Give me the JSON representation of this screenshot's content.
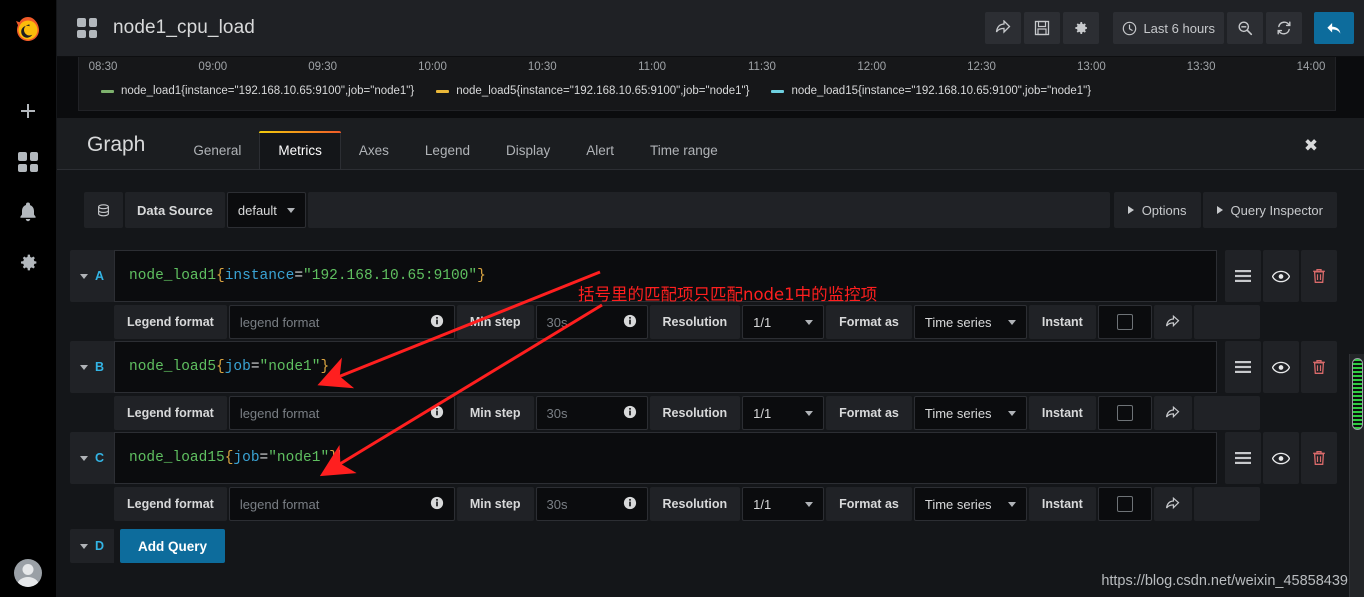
{
  "sidebar": {
    "logo": "grafana-logo",
    "items": [
      {
        "name": "create",
        "icon": "plus-icon"
      },
      {
        "name": "dashboards",
        "icon": "dashboards-icon"
      },
      {
        "name": "alerting",
        "icon": "bell-icon"
      },
      {
        "name": "configuration",
        "icon": "gear-icon"
      }
    ],
    "avatar": "user-avatar"
  },
  "topbar": {
    "dashboard_icon": "dashboards-icon",
    "title": "node1_cpu_load",
    "share_label": "",
    "save_label": "",
    "settings_label": "",
    "time_range": "Last 6 hours",
    "time_icon": "clock-icon",
    "zoom_out_label": "",
    "refresh_label": "",
    "back_label": ""
  },
  "graph": {
    "axis_ticks": [
      "08:30",
      "09:00",
      "09:30",
      "10:00",
      "10:30",
      "11:00",
      "11:30",
      "12:00",
      "12:30",
      "13:00",
      "13:30",
      "14:00"
    ],
    "legend": [
      {
        "label": "node_load1{instance=\"192.168.10.65:9100\",job=\"node1\"}",
        "color": "#7eb26d"
      },
      {
        "label": "node_load5{instance=\"192.168.10.65:9100\",job=\"node1\"}",
        "color": "#eab839"
      },
      {
        "label": "node_load15{instance=\"192.168.10.65:9100\",job=\"node1\"}",
        "color": "#6ed0e0"
      }
    ]
  },
  "chart_data": {
    "type": "line",
    "title": "node1_cpu_load",
    "xlabel": "",
    "ylabel": "",
    "x_ticks": [
      "08:30",
      "09:00",
      "09:30",
      "10:00",
      "10:30",
      "11:00",
      "11:30",
      "12:00",
      "12:30",
      "13:00",
      "13:30",
      "14:00"
    ],
    "series": [
      {
        "name": "node_load1{instance=\"192.168.10.65:9100\",job=\"node1\"}",
        "color": "#7eb26d",
        "values": []
      },
      {
        "name": "node_load5{instance=\"192.168.10.65:9100\",job=\"node1\"}",
        "color": "#eab839",
        "values": []
      },
      {
        "name": "node_load15{instance=\"192.168.10.65:9100\",job=\"node1\"}",
        "color": "#6ed0e0",
        "values": []
      }
    ],
    "legend_position": "bottom",
    "grid": false
  },
  "panel": {
    "title": "Graph",
    "tabs": [
      {
        "label": "General",
        "active": false
      },
      {
        "label": "Metrics",
        "active": true
      },
      {
        "label": "Axes",
        "active": false
      },
      {
        "label": "Legend",
        "active": false
      },
      {
        "label": "Display",
        "active": false
      },
      {
        "label": "Alert",
        "active": false
      },
      {
        "label": "Time range",
        "active": false
      }
    ],
    "close_label": "✖"
  },
  "datasource": {
    "icon": "database-icon",
    "label": "Data Source",
    "value": "default",
    "options_label": "Options",
    "query_inspector_label": "Query Inspector"
  },
  "options_row": {
    "legend_format_label": "Legend format",
    "legend_format_placeholder": "legend format",
    "min_step_label": "Min step",
    "min_step_placeholder": "30s",
    "resolution_label": "Resolution",
    "resolution_value": "1/1",
    "format_as_label": "Format as",
    "format_as_value": "Time series",
    "instant_label": "Instant",
    "instant_checked": false
  },
  "queries": [
    {
      "ref": "A",
      "expr_metric": "node_load1",
      "expr_open": "{",
      "expr_label": "instance",
      "expr_eq": "=",
      "expr_value": "\"192.168.10.65:9100\"",
      "expr_close": "}",
      "has_cursor": false
    },
    {
      "ref": "B",
      "expr_metric": "node_load5",
      "expr_open": "{",
      "expr_label": "job",
      "expr_eq": "=",
      "expr_value": "\"node1\"",
      "expr_close": "}",
      "has_cursor": false
    },
    {
      "ref": "C",
      "expr_metric": "node_load15",
      "expr_open": "{",
      "expr_label": "job",
      "expr_eq": "=",
      "expr_value": "\"node1\"",
      "expr_close": "}",
      "has_cursor": true
    }
  ],
  "add_query": {
    "ref": "D",
    "label": "Add Query"
  },
  "annotation": {
    "text": "括号里的匹配项只匹配node1中的监控项",
    "color": "#ff1f1f"
  },
  "watermark": "https://blog.csdn.net/weixin_45858439",
  "colors": {
    "accent_blue": "#0d6c9c",
    "ref_blue": "#33b5e5",
    "tab_gradient_start": "#f2cc0c",
    "tab_gradient_end": "#f05a28",
    "panel_bg": "#141619",
    "input_bg": "#0b0c0e"
  }
}
